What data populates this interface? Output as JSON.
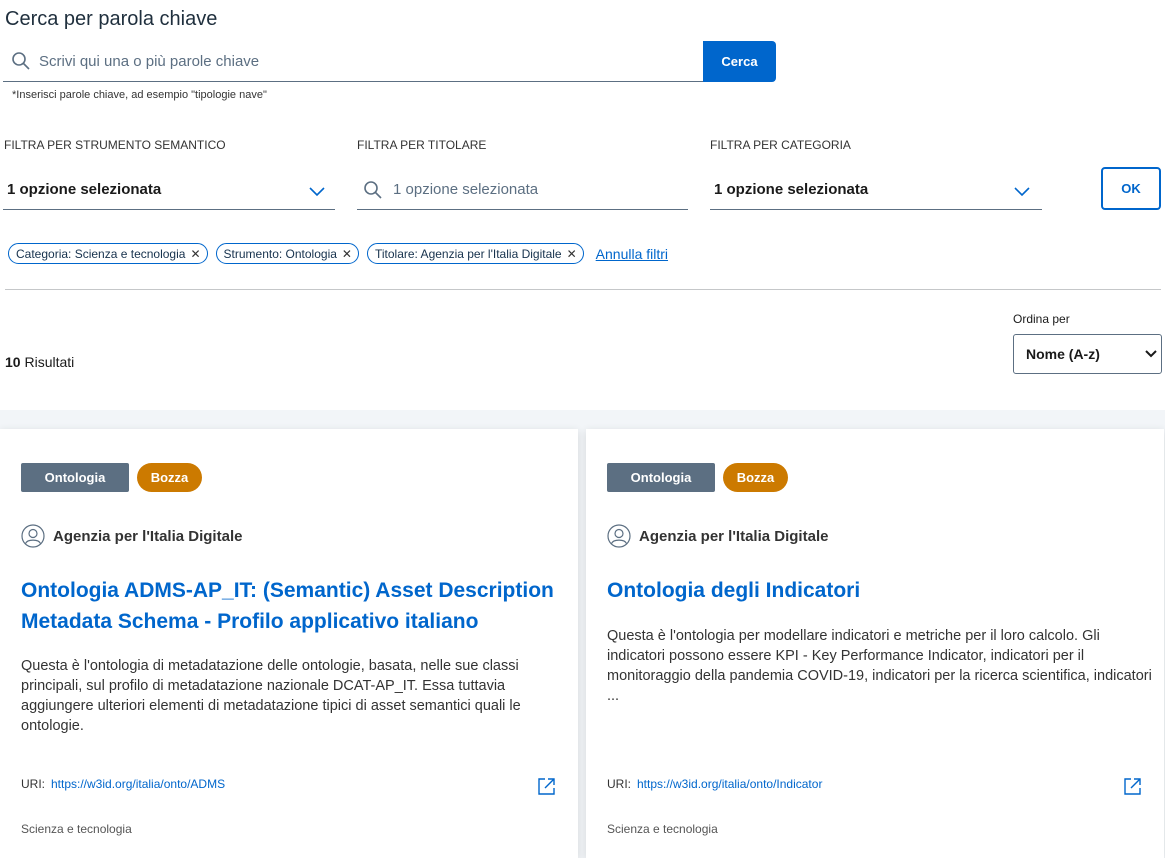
{
  "search": {
    "title": "Cerca per parola chiave",
    "placeholder": "Scrivi qui una o più parole chiave",
    "button_label": "Cerca",
    "hint": "*Inserisci parole chiave, ad esempio \"tipologie nave\""
  },
  "filters": {
    "strumento": {
      "label": "FILTRA PER STRUMENTO SEMANTICO",
      "value": "1 opzione selezionata"
    },
    "titolare": {
      "label": "FILTRA PER TITOLARE",
      "placeholder": "1 opzione selezionata"
    },
    "categoria": {
      "label": "FILTRA PER CATEGORIA",
      "value": "1 opzione selezionata"
    },
    "ok_label": "OK"
  },
  "active_filters": [
    {
      "label": "Categoria: Scienza e tecnologia"
    },
    {
      "label": "Strumento: Ontologia"
    },
    {
      "label": "Titolare: Agenzia per l'Italia Digitale"
    }
  ],
  "reset_label": "Annulla filtri",
  "sort": {
    "label": "Ordina per",
    "value": "Nome (A-z)"
  },
  "results": {
    "count": "10",
    "label": "Risultati"
  },
  "cards": [
    {
      "type": "Ontologia",
      "status": "Bozza",
      "owner": "Agenzia per l'Italia Digitale",
      "title": "Ontologia ADMS-AP_IT: (Semantic) Asset Description Metadata Schema - Profilo applicativo italiano",
      "description": "Questa è l'ontologia di metadatazione delle ontologie, basata, nelle sue classi principali, sul profilo di metadatazione nazionale DCAT-AP_IT. Essa tuttavia aggiungere ulteriori elementi di metadatazione tipici di asset semantici quali le ontologie.",
      "uri_label": "URI:",
      "uri": "https://w3id.org/italia/onto/ADMS",
      "category": "Scienza e tecnologia"
    },
    {
      "type": "Ontologia",
      "status": "Bozza",
      "owner": "Agenzia per l'Italia Digitale",
      "title": "Ontologia degli Indicatori",
      "description": "Questa è l'ontologia per modellare indicatori e metriche per il loro calcolo. Gli indicatori possono essere KPI - Key Performance Indicator, indicatori per il monitoraggio della pandemia COVID-19, indicatori per la ricerca scientifica, indicatori ...",
      "uri_label": "URI:",
      "uri": "https://w3id.org/italia/onto/Indicator",
      "category": "Scienza e tecnologia"
    }
  ],
  "colors": {
    "primary": "#0066cc",
    "badge_type": "#5c6f82",
    "badge_status": "#cc7a00",
    "results_bg": "#f2f5f8"
  },
  "icons": {
    "search": "search-icon",
    "chevron": "chevron-down-icon",
    "owner": "user-icon",
    "external": "external-link-icon",
    "remove": "close-icon"
  }
}
